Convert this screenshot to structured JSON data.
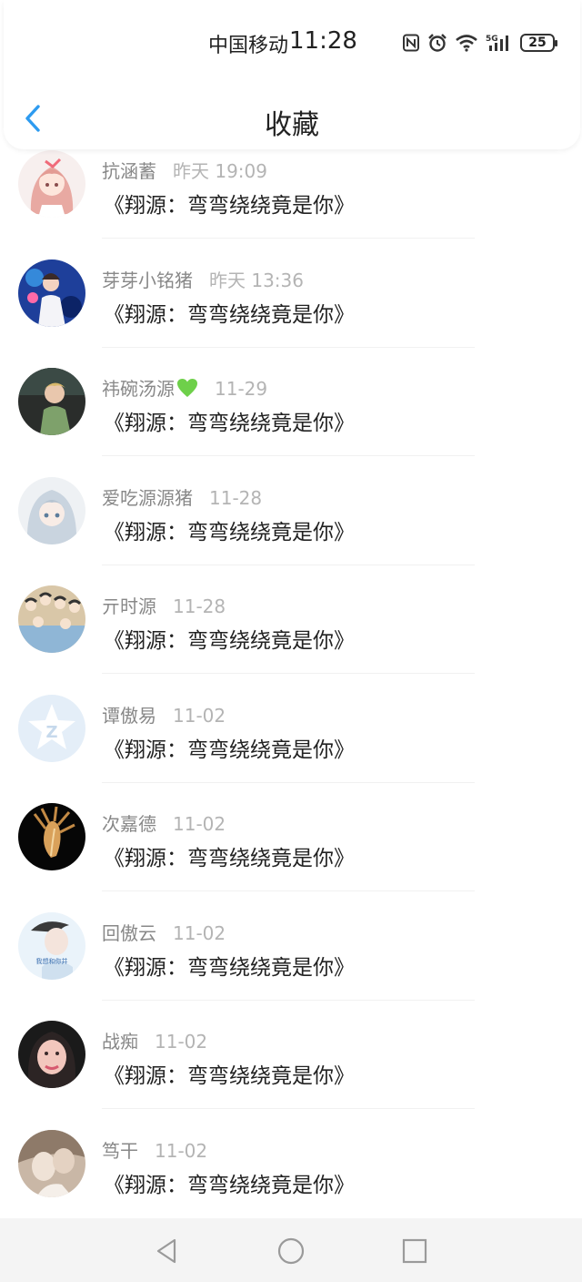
{
  "status_bar": {
    "carrier": "中国移动",
    "time": "11:28",
    "battery": "25",
    "icons": [
      "nfc-icon",
      "alarm-icon",
      "wifi-icon",
      "5g-signal-icon",
      "battery-icon"
    ]
  },
  "navbar": {
    "back_icon": "chevron-left-icon",
    "title": "收藏",
    "accent": "#2d9bf0"
  },
  "items": [
    {
      "name": "抗涵蓄",
      "time": "昨天 19:09",
      "message": "《翔源：弯弯绕绕竟是你》",
      "avatar": "anime-girl-avatar"
    },
    {
      "name": "芽芽小铭猪",
      "time": "昨天 13:36",
      "message": "《翔源：弯弯绕绕竟是你》",
      "avatar": "stage-photo-avatar"
    },
    {
      "name": "祎碗汤源",
      "time": "11-29",
      "message": "《翔源：弯弯绕绕竟是你》",
      "avatar": "night-portrait-avatar",
      "badge_icon": "green-heart-icon"
    },
    {
      "name": "爱吃源源猪",
      "time": "11-28",
      "message": "《翔源：弯弯绕绕竟是你》",
      "avatar": "anime-silver-hair-avatar"
    },
    {
      "name": "亓时源",
      "time": "11-28",
      "message": "《翔源：弯弯绕绕竟是你》",
      "avatar": "cartoon-group-avatar"
    },
    {
      "name": "谭傲易",
      "time": "11-02",
      "message": "《翔源：弯弯绕绕竟是你》",
      "avatar": "qzone-default-avatar"
    },
    {
      "name": "次嘉德",
      "time": "11-02",
      "message": "《翔源：弯弯绕绕竟是你》",
      "avatar": "seashell-avatar"
    },
    {
      "name": "回傲云",
      "time": "11-02",
      "message": "《翔源：弯弯绕绕竟是你》",
      "avatar": "portrait-caption-avatar",
      "avatar_caption": "我想和你并"
    },
    {
      "name": "战痴",
      "time": "11-02",
      "message": "《翔源：弯弯绕绕竟是你》",
      "avatar": "selfie-avatar"
    },
    {
      "name": "笃干",
      "time": "11-02",
      "message": "《翔源：弯弯绕绕竟是你》",
      "avatar": "sepia-photo-avatar"
    }
  ],
  "bottom_nav": [
    "back-triangle-icon",
    "home-circle-icon",
    "recents-square-icon"
  ]
}
